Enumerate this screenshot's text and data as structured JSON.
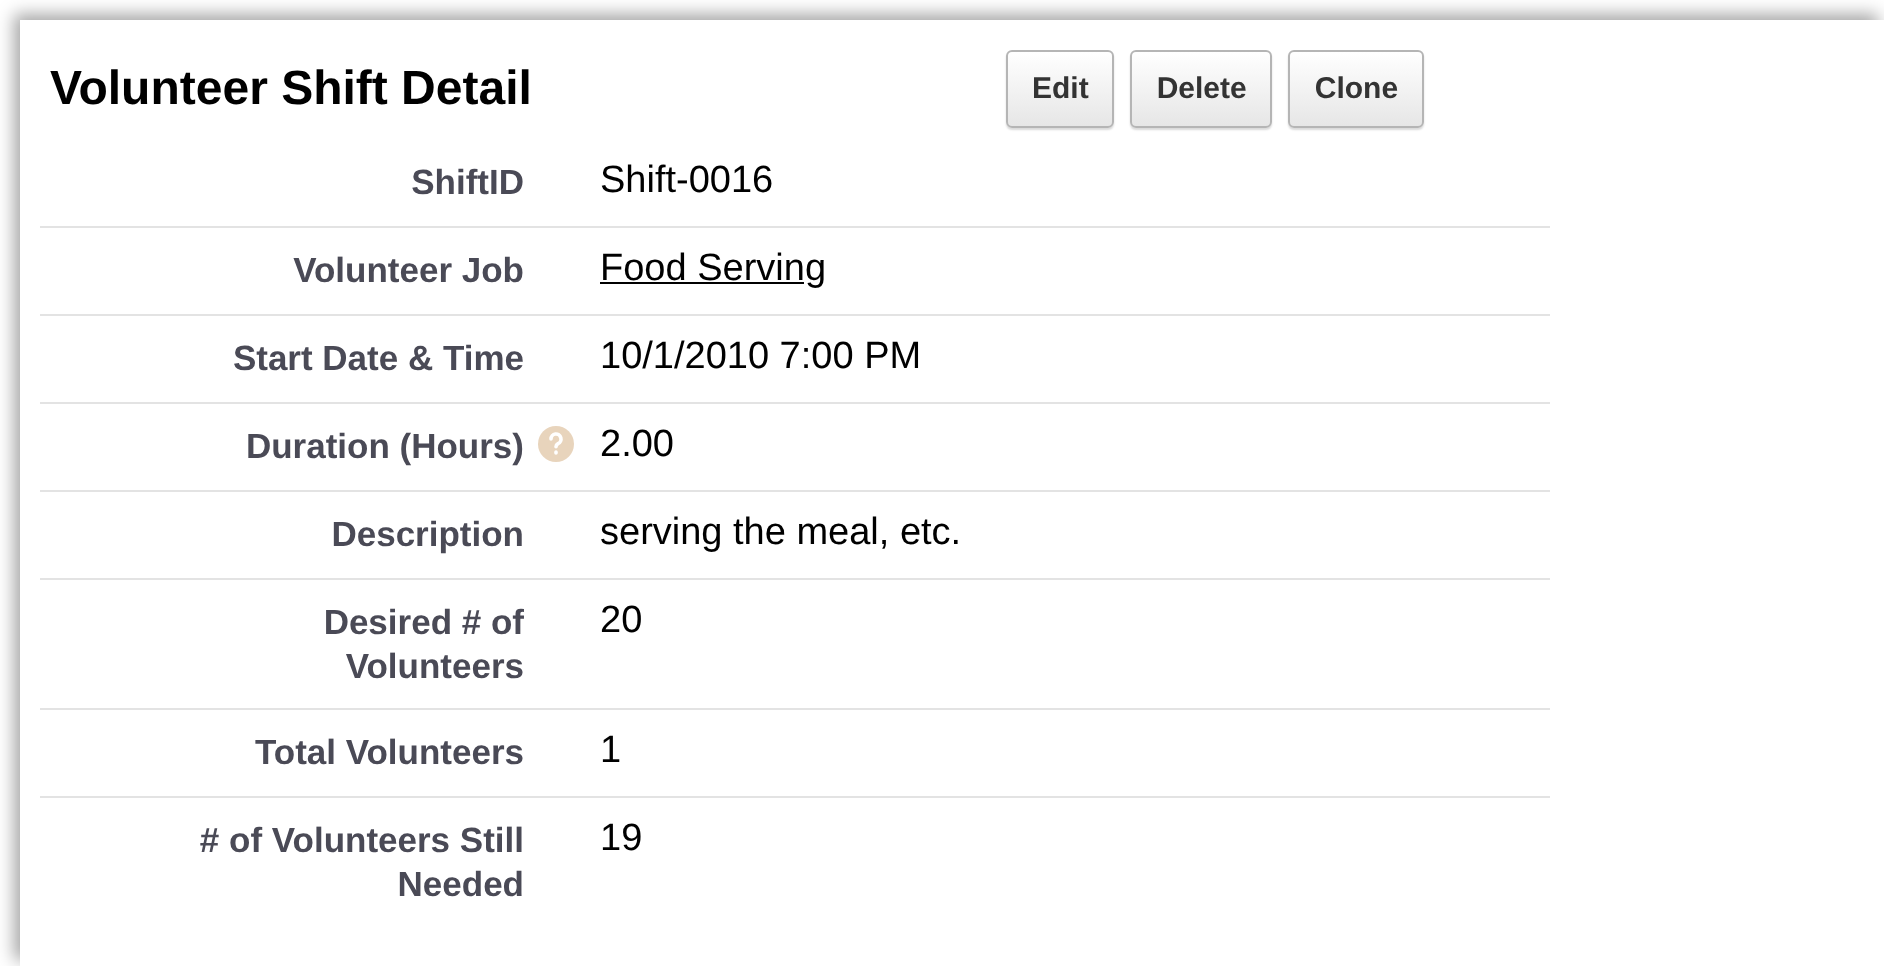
{
  "title": "Volunteer Shift Detail",
  "buttons": [
    "Edit",
    "Delete",
    "Clone"
  ],
  "fields": [
    {
      "label": "ShiftID",
      "value": "Shift-0016",
      "kind": "text",
      "help": false
    },
    {
      "label": "Volunteer Job",
      "value": "Food Serving",
      "kind": "link",
      "help": false
    },
    {
      "label": "Start Date & Time",
      "value": "10/1/2010 7:00 PM",
      "kind": "text",
      "help": false
    },
    {
      "label": "Duration (Hours)",
      "value": "2.00",
      "kind": "text",
      "help": true
    },
    {
      "label": "Description",
      "value": "serving the meal, etc.",
      "kind": "text",
      "help": false
    },
    {
      "label": "Desired # of Volunteers",
      "value": "20",
      "kind": "text",
      "help": false
    },
    {
      "label": "Total Volunteers",
      "value": "1",
      "kind": "text",
      "help": false
    },
    {
      "label": "# of Volunteers Still Needed",
      "value": "19",
      "kind": "text",
      "help": false
    }
  ]
}
